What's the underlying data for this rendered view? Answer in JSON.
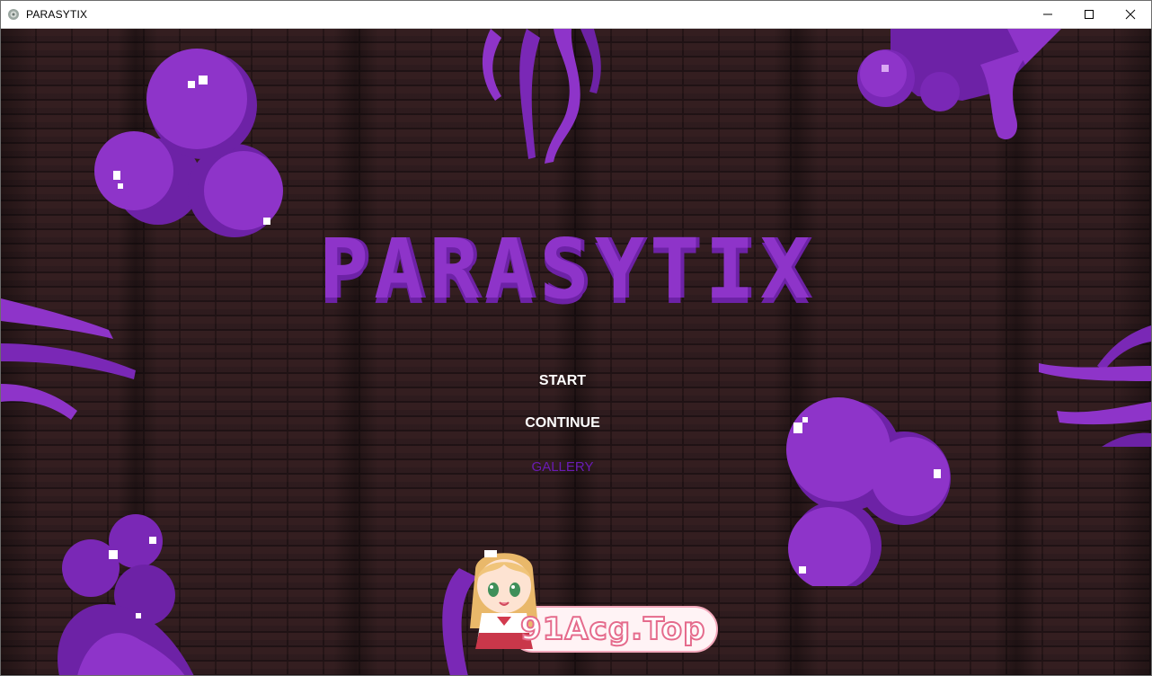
{
  "window": {
    "title": "PARASYTIX",
    "icon": "app-icon",
    "controls": [
      "minimize-icon",
      "maximize-icon",
      "close-icon"
    ]
  },
  "game": {
    "logo_text": "PARASYTIX",
    "menu": {
      "start_label": "START",
      "continue_label": "CONTINUE",
      "gallery_label": "GALLERY"
    },
    "watermark_text": "91Acg.Top"
  },
  "colors": {
    "brick_background": "#2c1b1d",
    "parasite_purple": "#8e34c9",
    "parasite_shadow": "#6d22a6",
    "menu_text": "#ffffff",
    "menu_disabled": "#6a1bb4"
  }
}
